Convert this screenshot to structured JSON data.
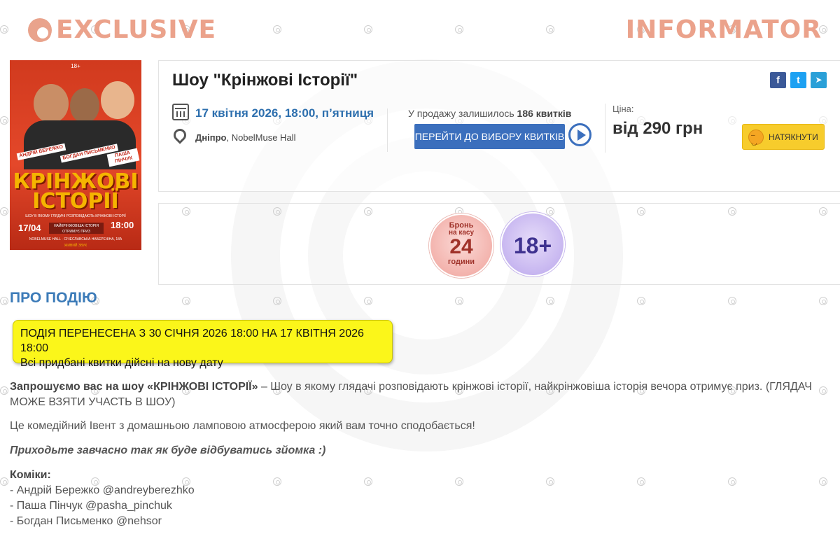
{
  "watermark": {
    "left_text": "EXCLUSIVE",
    "right_text": "INFORMATOR",
    "color": "#eba28b"
  },
  "poster": {
    "age": "18+",
    "title_line1": "КРІНЖОВІ",
    "title_line2": "ІСТОРІЇ",
    "subtitle": "ШОУ В ЯКОМУ ГЛЯДАЧІ РОЗПОВІДАЮТЬ КРІНЖОВІ ІСТОРІЇ",
    "date": "17/04",
    "badge": "НАЙКРІНЖОВІША ІСТОРІЯ ОТРИМУЄ ПРИЗ",
    "time": "18:00",
    "venue": "NOBELMUSE HALL · СІЧЕСЛАВСЬКА НАБЕРЕЖНА, 18А",
    "name1": "АНДРІЙ БЕРЕЖКО",
    "name2": "БОГДАН ПИСЬМЕНКО",
    "name3": "ПАША ПІНЧУК",
    "bottom": "ЖИВИЙ ЗВУК"
  },
  "event": {
    "title": "Шоу \"Крінжові Історії\"",
    "date": "17 квітня 2026, 18:00, п’ятниця",
    "venue_city": "Дніпро",
    "venue_name": ", NobelMuse Hall",
    "tickets_left_prefix": "У продажу залишилось ",
    "tickets_left_count": "186 квитків",
    "buy_button": "ПЕРЕЙТИ ДО ВИБОРУ КВИТКІВ",
    "price_label": "Ціна:",
    "price_value": "від 290 грн",
    "nudge_button": "НАТЯКНУТИ"
  },
  "share": {
    "facebook": "f",
    "twitter": "t",
    "telegram": "➤",
    "colors": {
      "facebook": "#3b5998",
      "twitter": "#1da1f2",
      "telegram": "#2aa0d8"
    }
  },
  "badges": {
    "bron_top": "Бронь",
    "bron_mid": "на касу",
    "bron_num": "24",
    "bron_bottom": "години",
    "age": "18+"
  },
  "about": {
    "title": "ПРО ПОДІЮ",
    "notice_line1": "ПОДІЯ ПЕРЕНЕСЕНА З 30 СІЧНЯ 2026 18:00 НА 17 КВІТНЯ 2026 18:00",
    "notice_line2": "Всі придбані квитки дійсні на нову дату",
    "p1_bold": "Запрошуємо вас на шоу «КРІНЖОВІ ІСТОРІЇ» ",
    "p1_rest": "– Шоу в якому глядачі розповідають крінжові історії, найкрінжовіша історія вечора отримує приз. (ГЛЯДАЧ МОЖЕ ВЗЯТИ УЧАСТЬ В ШОУ)",
    "p2": "Це комедійний Івент з домашньою ламповою атмосферою який вам точно сподобається!",
    "p3": "Приходьте завчасно так як буде відбуватись зйомка :)",
    "comics_title": "Коміки:",
    "comics": [
      "- Андрій Бережко @andreyberezhko",
      "- Паша Пінчук @pasha_pinchuk",
      "- Богдан Письменко @nehsor"
    ]
  }
}
